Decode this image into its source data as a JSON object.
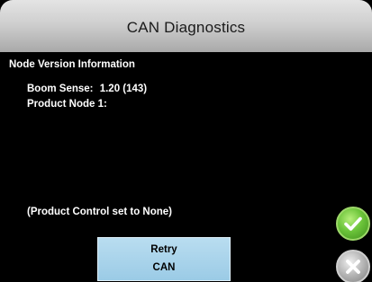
{
  "header": {
    "title": "CAN Diagnostics"
  },
  "node_info": {
    "heading": "Node Version Information",
    "boom_sense_label": "Boom Sense:",
    "boom_sense_value": "1.20 (143)",
    "product_node_label": "Product Node 1:",
    "product_node_value": ""
  },
  "note": "(Product Control set to None)",
  "retry_button": {
    "line1": "Retry",
    "line2": "CAN"
  },
  "actions": {
    "accept_icon": "check-icon",
    "cancel_icon": "close-icon",
    "accept_color": "#6cc43a",
    "cancel_color": "#b4b4b4"
  }
}
